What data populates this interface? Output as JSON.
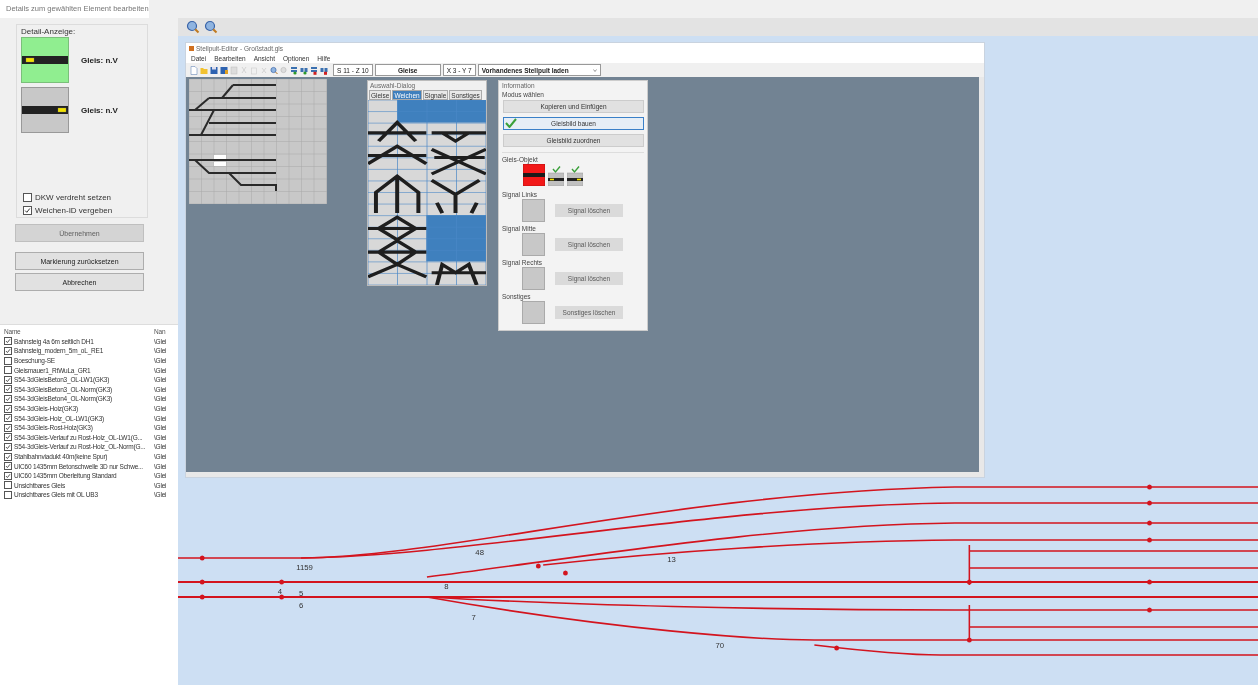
{
  "window": {
    "title": "Details zum gewählten Element bearbeiten"
  },
  "detail": {
    "heading": "Detail-Anzeige:",
    "previews": [
      {
        "label": "Gleis: n.V",
        "selected": true
      },
      {
        "label": "Gleis: n.V",
        "selected": false
      }
    ]
  },
  "options": [
    {
      "label": "DKW verdreht setzen",
      "checked": false
    },
    {
      "label": "Weichen-ID vergeben",
      "checked": true
    }
  ],
  "buttons": [
    {
      "label": "Übernehmen",
      "disabled": true
    },
    {
      "label": "Markierung zurücksetzen",
      "disabled": false
    },
    {
      "label": "Abbrechen",
      "disabled": false
    }
  ],
  "layer_list": {
    "columns": [
      "Name",
      "Nan"
    ],
    "rows": [
      {
        "name": "Bahnsteig 4a 6m seitlich DH1",
        "path": "\\Glei",
        "checked": true
      },
      {
        "name": "Bahnsteig_modern_5m_oL_RE1",
        "path": "\\Glei",
        "checked": true
      },
      {
        "name": "Boeschung-SE",
        "path": "\\Glei",
        "checked": false
      },
      {
        "name": "Gleismauer1_RtWuLa_GR1",
        "path": "\\Glei",
        "checked": false
      },
      {
        "name": "S54-3dGleisBeton3_OL-LW1(GK3)",
        "path": "\\Glei",
        "checked": true
      },
      {
        "name": "S54-3dGleisBeton3_OL-Norm(GK3)",
        "path": "\\Glei",
        "checked": true
      },
      {
        "name": "S54-3dGleisBeton4_OL-Norm(GK3)",
        "path": "\\Glei",
        "checked": true
      },
      {
        "name": "S54-3dGleis-Holz(GK3)",
        "path": "\\Glei",
        "checked": true
      },
      {
        "name": "S54-3dGleis-Holz_OL-LW1(GK3)",
        "path": "\\Glei",
        "checked": true
      },
      {
        "name": "S54-3dGleis-Rost-Holz(GK3)",
        "path": "\\Glei",
        "checked": true
      },
      {
        "name": "S54-3dGleis-Verlauf zu Rost-Holz_OL-LW1(G...",
        "path": "\\Glei",
        "checked": true
      },
      {
        "name": "S54-3dGleis-Verlauf zu Rost-Holz_OL-Norm(G...",
        "path": "\\Glei",
        "checked": true
      },
      {
        "name": "Stahlbahnviadukt 40m(keine Spur)",
        "path": "\\Glei",
        "checked": true
      },
      {
        "name": "UIC60 1435mm Betonschwelle 3D nur Schwe...",
        "path": "\\Glei",
        "checked": true
      },
      {
        "name": "UIC60 1435mm Oberleitung Standard",
        "path": "\\Glei",
        "checked": true
      },
      {
        "name": "Unsichtbares Gleis",
        "path": "\\Glei",
        "checked": false
      },
      {
        "name": "Unsichtbares Gleis mit OL UB3",
        "path": "\\Glei",
        "checked": false
      }
    ]
  },
  "editor": {
    "title": "Stellpult-Editor - Großstadt.gls",
    "menu": [
      "Datei",
      "Bearbeiten",
      "Ansicht",
      "Optionen",
      "Hilfe"
    ],
    "position": "S 11 - Z 10",
    "category": "Gleise",
    "coordinates": "X 3 - Y 7",
    "dropdown": "Vorhandenes Stellpult laden",
    "selection_dialog": {
      "title": "Auswahl-Dialog",
      "tabs": [
        {
          "label": "Gleise",
          "selected": false
        },
        {
          "label": "Weichen",
          "selected": true
        },
        {
          "label": "Signale",
          "selected": false
        },
        {
          "label": "Sonstiges",
          "selected": false
        }
      ]
    },
    "info_panel": {
      "title": "Information",
      "mode_heading": "Modus wählen",
      "modes": [
        {
          "label": "Kopieren und Einfügen",
          "selected": false
        },
        {
          "label": "Gleisbild bauen",
          "selected": true
        },
        {
          "label": "Gleisbild zuordnen",
          "selected": false
        }
      ],
      "object_heading": "Gleis-Objekt",
      "slots": [
        {
          "heading": "Signal Links",
          "button": "Signal löschen",
          "disabled": true
        },
        {
          "heading": "Signal Mitte",
          "button": "Signal löschen",
          "disabled": true
        },
        {
          "heading": "Signal Rechts",
          "button": "Signal löschen",
          "disabled": true
        },
        {
          "heading": "Sonstiges",
          "button": "Sonstiges löschen",
          "disabled": true
        }
      ]
    }
  },
  "track_labels": [
    "1159",
    "48",
    "13",
    "8",
    "4",
    "5",
    "6",
    "7",
    "70"
  ]
}
